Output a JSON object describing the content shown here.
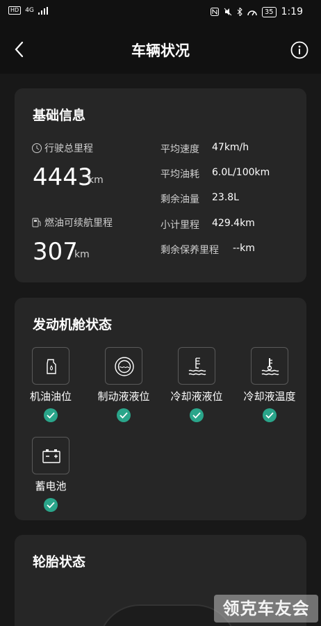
{
  "status_bar": {
    "hd": "HD",
    "net": "4G",
    "battery": "35",
    "time": "1:19"
  },
  "header": {
    "title": "车辆状况"
  },
  "basic_info": {
    "title": "基础信息",
    "total_mileage_label": "行驶总里程",
    "total_mileage_value": "4443",
    "total_mileage_unit": "km",
    "range_label": "燃油可续航里程",
    "range_value": "307",
    "range_unit": "km",
    "items": [
      {
        "label": "平均速度",
        "value": "47km/h"
      },
      {
        "label": "平均油耗",
        "value": "6.0L/100km"
      },
      {
        "label": "剩余油量",
        "value": "23.8L"
      },
      {
        "label": "小计里程",
        "value": "429.4km"
      },
      {
        "label": "剩余保养里程",
        "value": "--km"
      }
    ]
  },
  "engine_bay": {
    "title": "发动机舱状态",
    "items": [
      {
        "label": "机油油位",
        "icon": "oil-can-icon",
        "status": "ok"
      },
      {
        "label": "制动液液位",
        "icon": "brake-fluid-icon",
        "status": "ok"
      },
      {
        "label": "冷却液液位",
        "icon": "coolant-level-icon",
        "status": "ok"
      },
      {
        "label": "冷却液温度",
        "icon": "coolant-temp-icon",
        "status": "ok"
      },
      {
        "label": "蓄电池",
        "icon": "battery-icon",
        "status": "ok"
      }
    ]
  },
  "tires": {
    "title": "轮胎状态"
  },
  "watermark": "领克车友会",
  "colors": {
    "background": "#111111",
    "card": "#262626",
    "ok_green": "#2aa58a"
  }
}
